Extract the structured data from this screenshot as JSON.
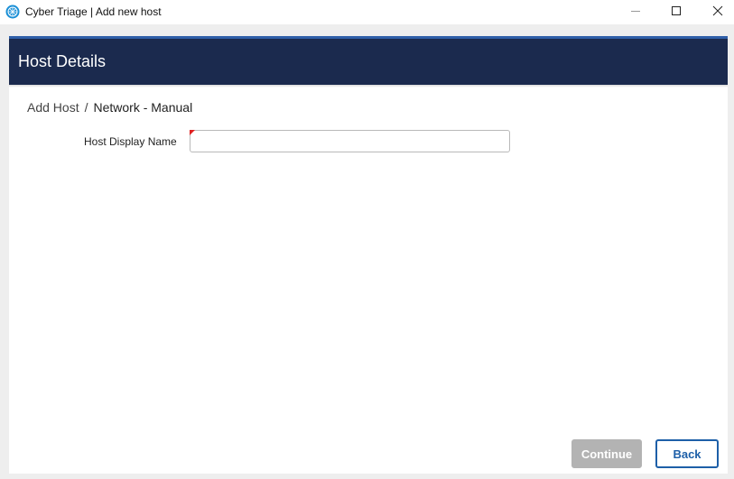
{
  "window": {
    "title": "Cyber Triage | Add new host",
    "icon": "cyber-triage-logo-icon",
    "controls": [
      "minimize-icon",
      "maximize-icon",
      "close-icon"
    ]
  },
  "header": {
    "title": "Host Details",
    "background_color": "#1b2a4e",
    "accent_color": "#2f5fa8"
  },
  "breadcrumb": {
    "items": [
      "Add Host",
      "/",
      "Network - Manual"
    ]
  },
  "form": {
    "host_display_name": {
      "label": "Host Display Name",
      "value": "",
      "placeholder": "",
      "required": true,
      "required_marker_color": "#e02020"
    }
  },
  "buttons": {
    "continue_label": "Continue",
    "continue_enabled": false,
    "back_label": "Back",
    "back_color": "#1d5fa8"
  }
}
